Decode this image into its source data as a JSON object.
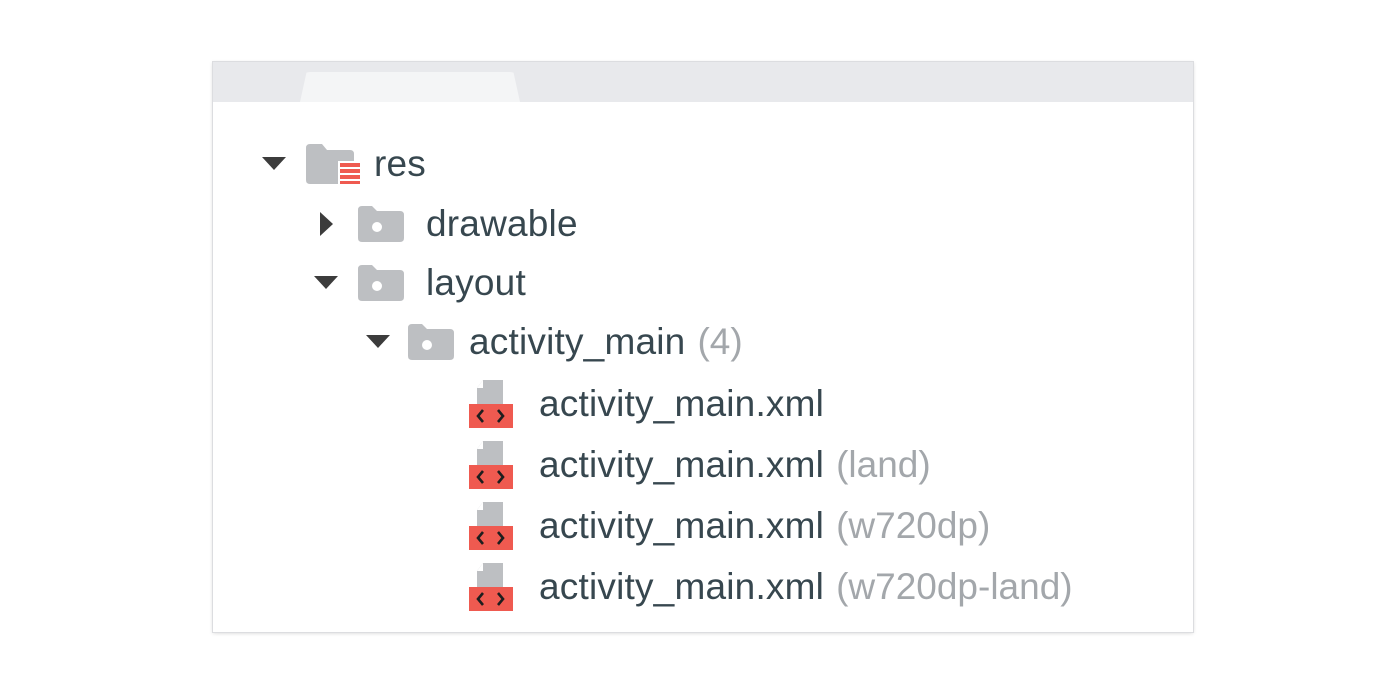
{
  "window": {
    "tab_label": ""
  },
  "tree": {
    "res": {
      "label": "res",
      "expanded": true,
      "icon": "resource-folder-icon"
    },
    "drawable": {
      "label": "drawable",
      "expanded": false,
      "icon": "folder-icon"
    },
    "layout": {
      "label": "layout",
      "expanded": true,
      "icon": "folder-icon"
    },
    "activity_main": {
      "label": "activity_main",
      "count": "(4)",
      "expanded": true,
      "icon": "folder-icon"
    },
    "files": [
      {
        "label": "activity_main.xml",
        "qualifier": "",
        "icon": "xml-file-icon"
      },
      {
        "label": "activity_main.xml",
        "qualifier": "(land)",
        "icon": "xml-file-icon"
      },
      {
        "label": "activity_main.xml",
        "qualifier": "(w720dp)",
        "icon": "xml-file-icon"
      },
      {
        "label": "activity_main.xml",
        "qualifier": "(w720dp-land)",
        "icon": "xml-file-icon"
      }
    ]
  },
  "colors": {
    "text": "#37474f",
    "qualifier": "#a3a7ab",
    "folder": "#bdbfc2",
    "accent": "#ef5a50",
    "arrow": "#3c3c3c"
  }
}
